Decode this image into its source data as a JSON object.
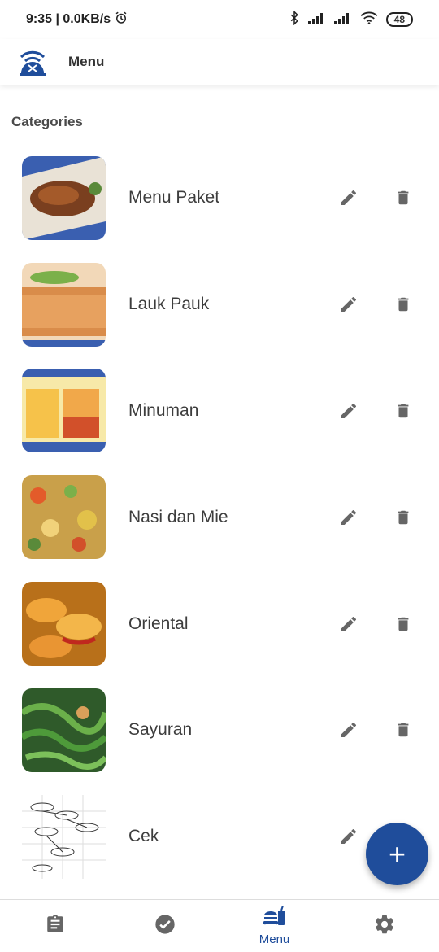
{
  "status": {
    "time_net": "9:35 | 0.0KB/s",
    "battery": "48",
    "icons": [
      "alarm-icon",
      "bluetooth-icon",
      "signal-icon",
      "signal-icon",
      "wifi-icon"
    ]
  },
  "appbar": {
    "title": "Menu",
    "logo": "restaurant-wifi-logo"
  },
  "section": {
    "title": "Categories"
  },
  "categories": [
    {
      "label": "Menu Paket"
    },
    {
      "label": "Lauk Pauk"
    },
    {
      "label": "Minuman"
    },
    {
      "label": "Nasi dan Mie"
    },
    {
      "label": "Oriental"
    },
    {
      "label": "Sayuran"
    },
    {
      "label": "Cek"
    }
  ],
  "fab": {
    "icon": "plus-icon",
    "symbol": "+"
  },
  "bottom_nav": {
    "items": [
      {
        "icon": "clipboard-icon",
        "label": ""
      },
      {
        "icon": "check-circle-icon",
        "label": ""
      },
      {
        "icon": "food-menu-icon",
        "label": "Menu"
      },
      {
        "icon": "gear-icon",
        "label": ""
      }
    ],
    "active_color": "#1f4d9b"
  },
  "colors": {
    "accent": "#1f4d9b",
    "icon_gray": "#666666"
  }
}
